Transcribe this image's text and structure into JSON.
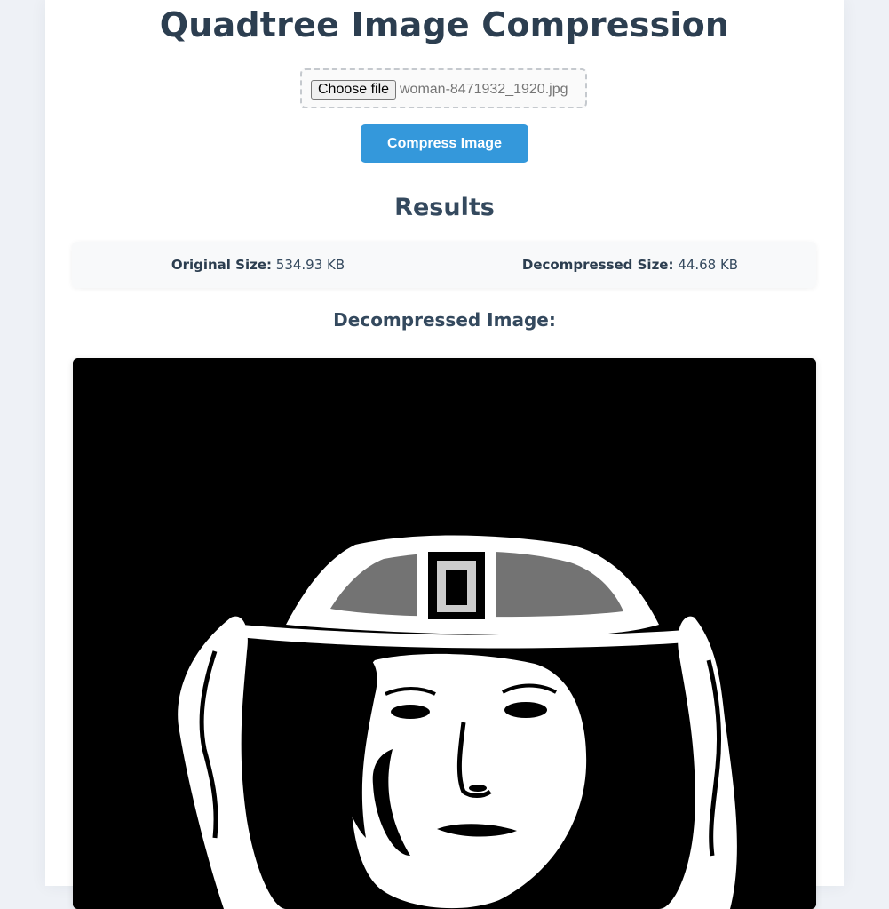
{
  "page": {
    "title": "Quadtree Image Compression"
  },
  "upload": {
    "choose_label": "Choose file",
    "file_name": "woman-8471932_1920.jpg"
  },
  "actions": {
    "compress_label": "Compress Image"
  },
  "results": {
    "title": "Results",
    "original_size_label": "Original Size:",
    "original_size_value": "534.93 KB",
    "decompressed_size_label": "Decompressed Size:",
    "decompressed_size_value": "44.68 KB"
  },
  "preview": {
    "title": "Decompressed Image:"
  },
  "colors": {
    "background": "#eef1f6",
    "heading": "#2c3e50",
    "accent": "#3498db"
  }
}
